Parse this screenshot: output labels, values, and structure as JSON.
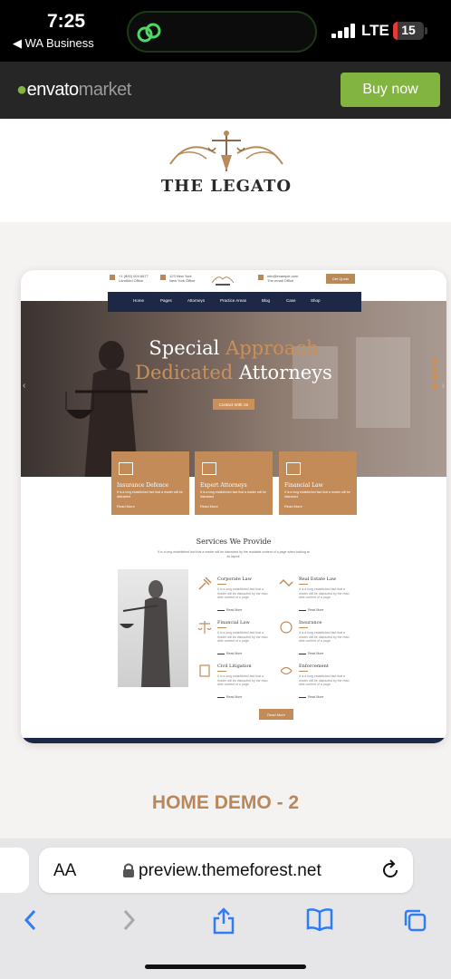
{
  "status": {
    "time": "7:25",
    "back_label": "◀ WA Business",
    "network": "LTE",
    "battery": "15",
    "battery_level": 0.15
  },
  "envato": {
    "logo_leaf": "●",
    "logo_main": "envato",
    "logo_market": "market",
    "buy_label": "Buy now"
  },
  "theme": {
    "brand_name": "THE LEGATO"
  },
  "preview": {
    "top_info": {
      "phone": "+1 (800) 004 6677",
      "phone_sub": "Landlord Office",
      "address": "123 New York",
      "address_sub": "New York Office",
      "email": "info@example.com",
      "email_sub": "The email Office",
      "appointment": "Get Quote"
    },
    "nav": [
      "Home",
      "Pages",
      "Attorneys",
      "Practice Areas",
      "Blog",
      "Case",
      "Shop"
    ],
    "hero": {
      "line1_plain": "Special",
      "line1_accent": "Approach",
      "line2_accent": "Dedicated",
      "line2_plain": "Attorneys",
      "button": "Contact With Us"
    },
    "features": [
      {
        "title": "Insurance Defence",
        "desc": "It is a long established fact that a reader will be distracted",
        "more": "Read More"
      },
      {
        "title": "Expert Attorneys",
        "desc": "It is a long established fact that a reader will be distracted",
        "more": "Read More"
      },
      {
        "title": "Financial Law",
        "desc": "It is a long established fact that a reader will be distracted",
        "more": "Read More"
      }
    ],
    "services": {
      "title": "Services We Provide",
      "subtitle": "It is a long established fact that a reader will be distracted by the readable content of a page when looking at its layout.",
      "items": [
        {
          "title": "Corporate Law",
          "desc": "It is a long established fact that a reader will be distracted by the read able content of a page.",
          "more": "Read More"
        },
        {
          "title": "Real Estate Law",
          "desc": "It is a long established fact that a reader will be distracted by the read able content of a page.",
          "more": "Read More"
        },
        {
          "title": "Financial Law",
          "desc": "It is a long established fact that a reader will be distracted by the read able content of a page.",
          "more": "Read More"
        },
        {
          "title": "Insurance",
          "desc": "It is a long established fact that a reader will be distracted by the read able content of a page.",
          "more": "Read More"
        },
        {
          "title": "Civil Litigation",
          "desc": "It is a long established fact that a reader will be distracted by the read able content of a page.",
          "more": "Read More"
        },
        {
          "title": "Enforcement",
          "desc": "It is a long established fact that a reader will be distracted by the read able content of a page.",
          "more": "Read More"
        }
      ],
      "button": "Read More"
    }
  },
  "demo_title": "HOME DEMO - 2",
  "browser": {
    "aa_label": "AA",
    "url": "preview.themeforest.net"
  },
  "colors": {
    "envato_green": "#82b440",
    "accent_gold": "#c28b58",
    "navy": "#1d2746",
    "ios_blue": "#2f7cf6"
  }
}
